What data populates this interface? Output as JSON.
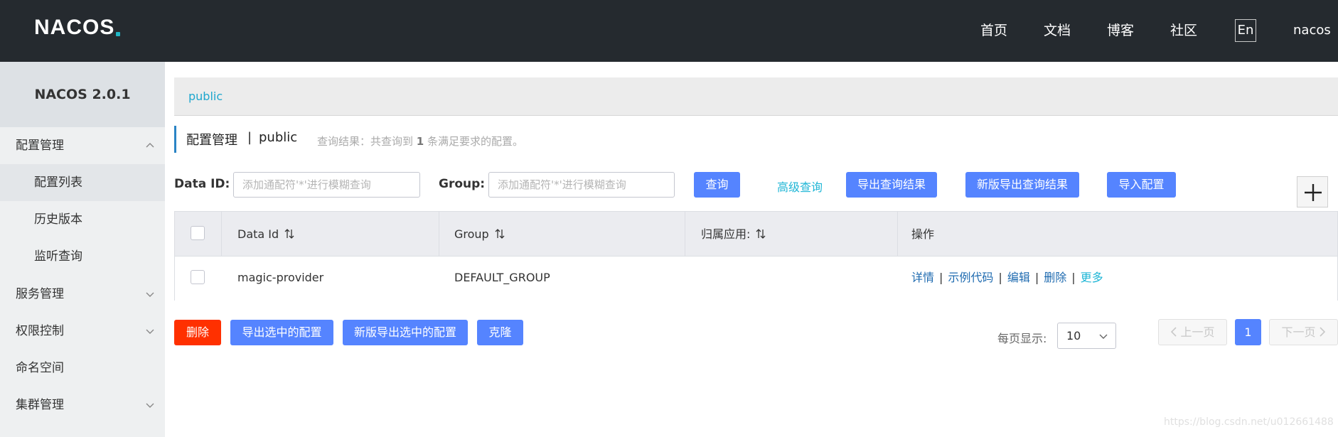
{
  "header": {
    "logo": "NACOS",
    "nav": [
      "首页",
      "文档",
      "博客",
      "社区"
    ],
    "lang": "En",
    "user": "nacos"
  },
  "sidebar": {
    "version": "NACOS 2.0.1",
    "items": [
      {
        "label": "配置管理",
        "expanded": true
      },
      {
        "label": "配置列表",
        "active": true
      },
      {
        "label": "历史版本"
      },
      {
        "label": "监听查询"
      },
      {
        "label": "服务管理",
        "expanded": false
      },
      {
        "label": "权限控制",
        "expanded": false
      },
      {
        "label": "命名空间"
      },
      {
        "label": "集群管理",
        "expanded": false
      }
    ]
  },
  "namespace_tab": "public",
  "page_title": {
    "title": "配置管理",
    "separator": "|",
    "namespace": "public",
    "result_prefix": "查询结果：共查询到",
    "result_count": "1",
    "result_suffix": "条满足要求的配置。"
  },
  "search": {
    "data_id_label": "Data ID:",
    "data_id_placeholder": "添加通配符'*'进行模糊查询",
    "group_label": "Group:",
    "group_placeholder": "添加通配符'*'进行模糊查询",
    "query_button": "查询",
    "advanced_link": "高级查询",
    "export_button": "导出查询结果",
    "new_export_button": "新版导出查询结果",
    "import_button": "导入配置"
  },
  "table": {
    "columns": [
      "Data Id",
      "Group",
      "归属应用:",
      "操作"
    ],
    "rows": [
      {
        "data_id": "magic-provider",
        "group": "DEFAULT_GROUP",
        "app": "",
        "ops": [
          "详情",
          "示例代码",
          "编辑",
          "删除",
          "更多"
        ]
      }
    ]
  },
  "footer": {
    "delete_button": "删除",
    "export_selected": "导出选中的配置",
    "new_export_selected": "新版导出选中的配置",
    "clone_button": "克隆",
    "page_size_label": "每页显示:",
    "page_size": "10",
    "prev": "上一页",
    "current_page": "1",
    "next": "下一页"
  },
  "watermark": "https://blog.csdn.net/u012661488",
  "colors": {
    "header_bg": "#252a2f",
    "primary": "#5584ff",
    "danger": "#ff3000",
    "link": "#1fb6d6"
  }
}
